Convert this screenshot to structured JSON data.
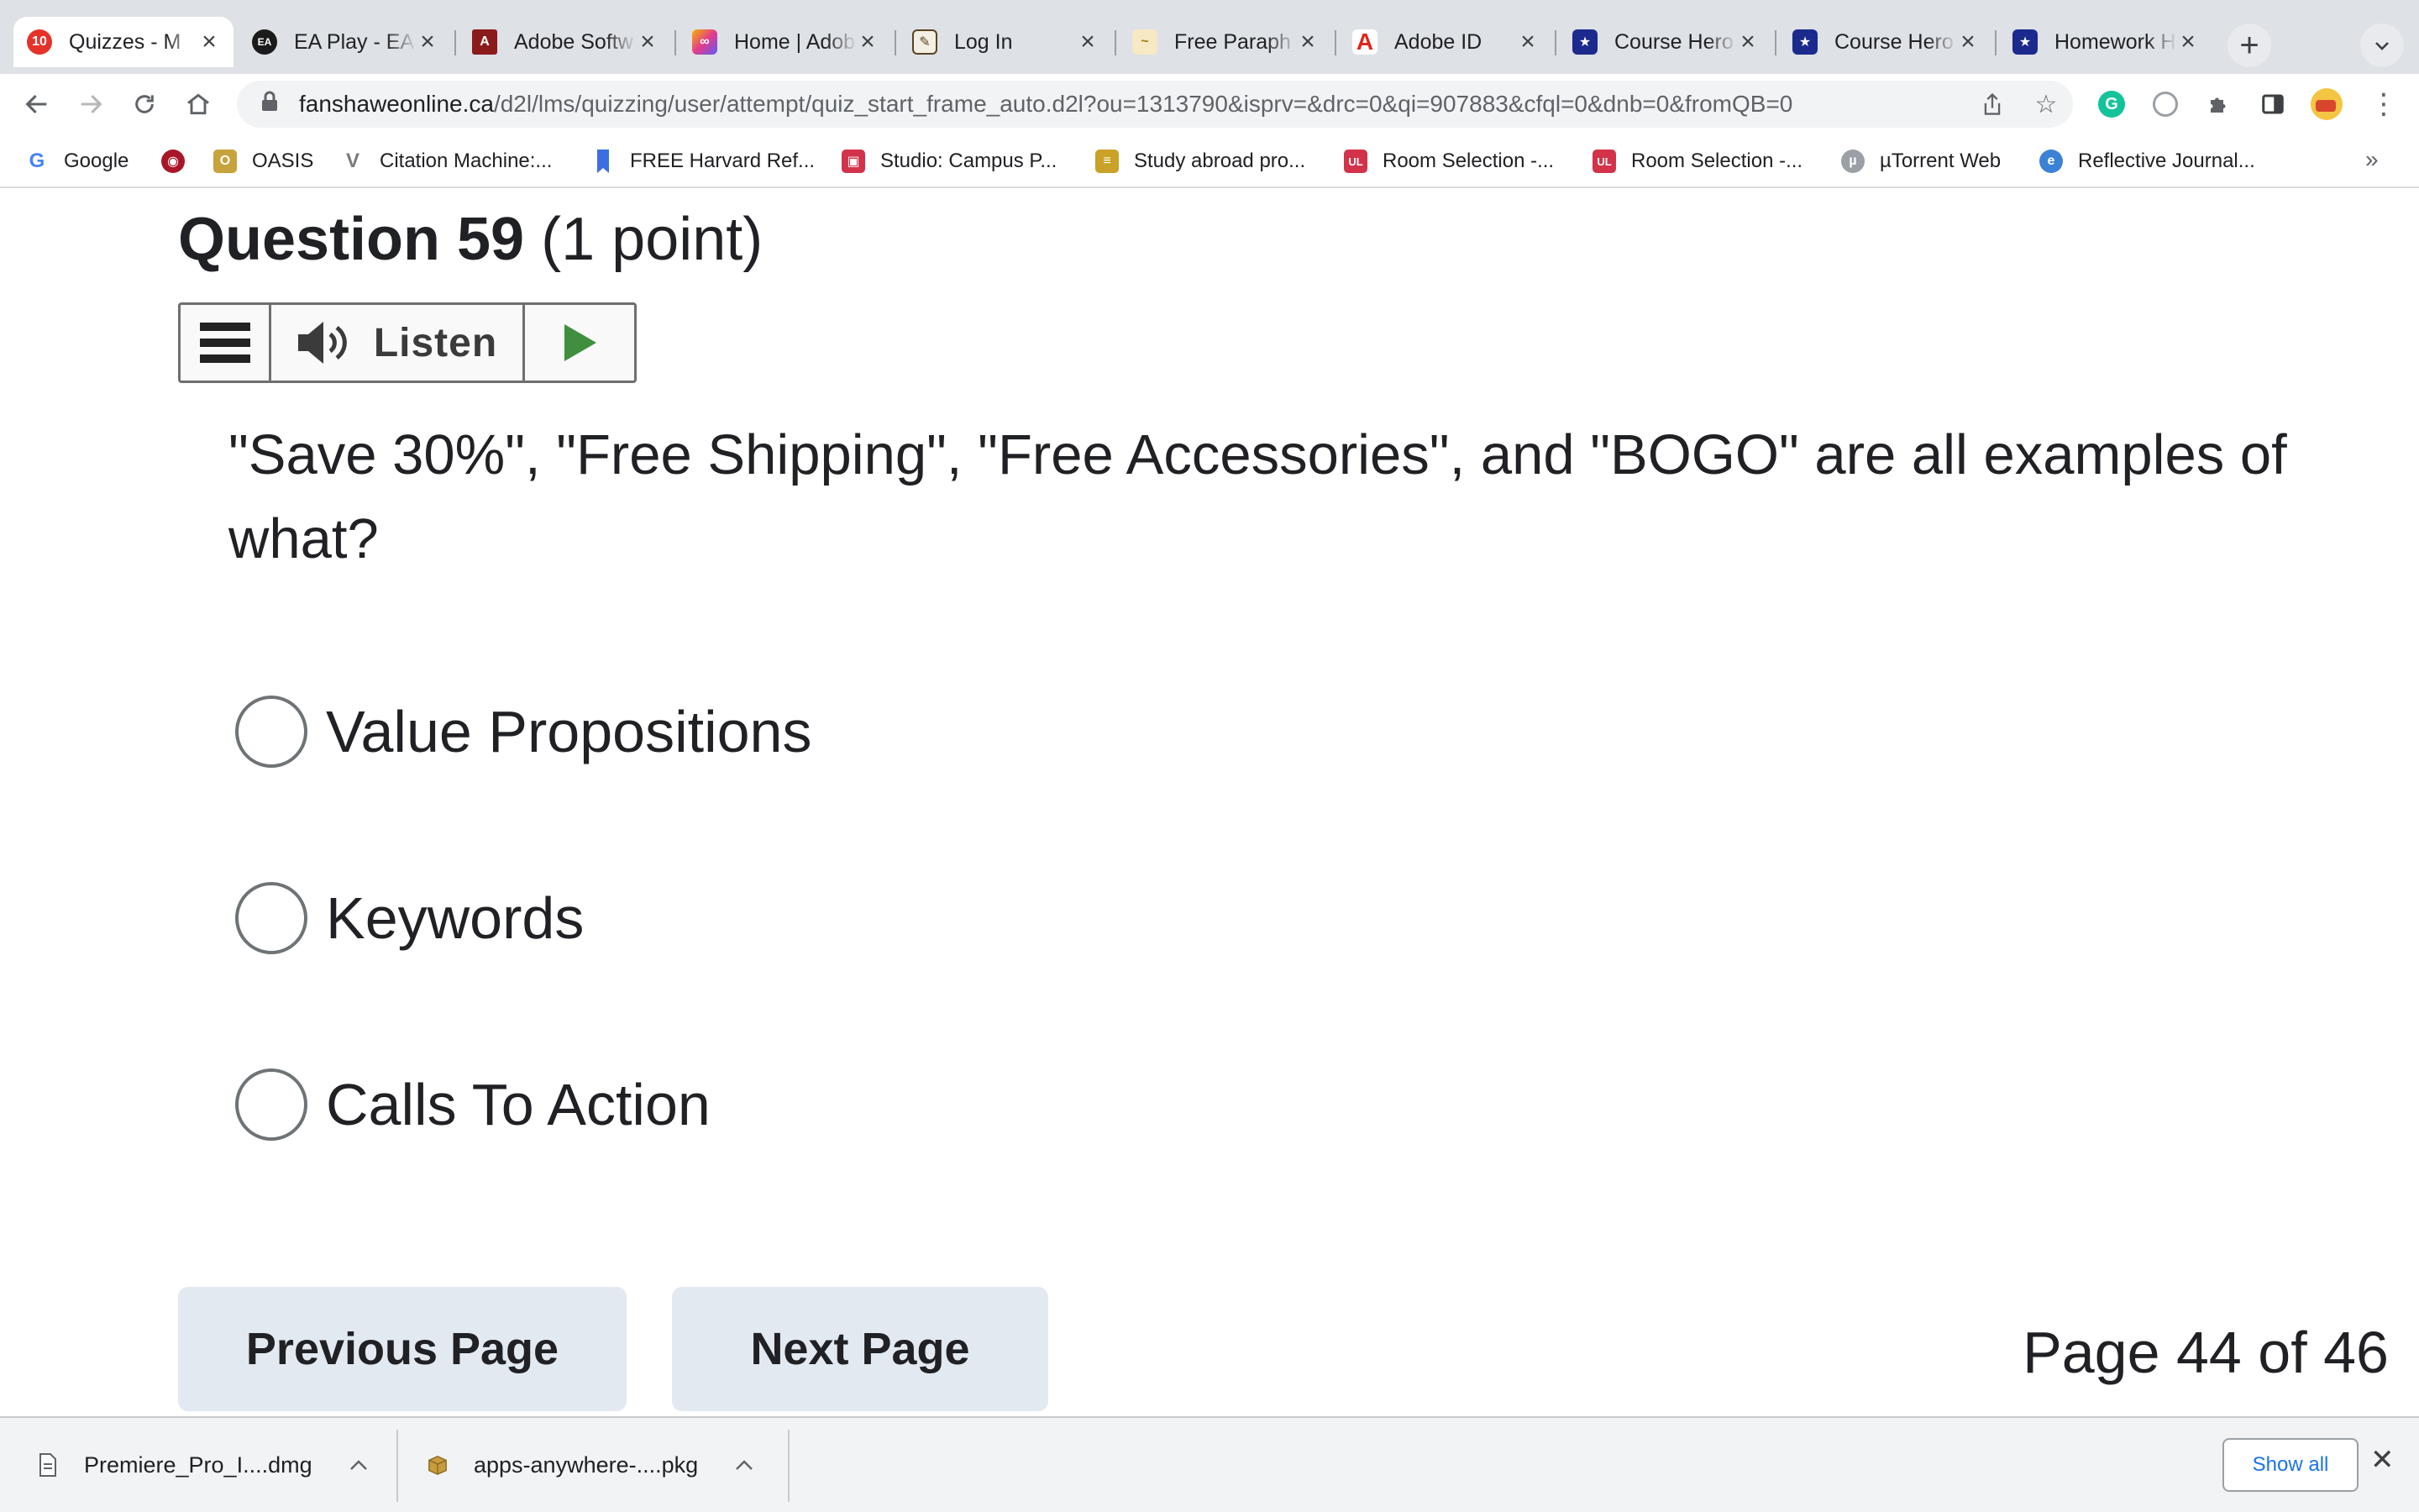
{
  "browser": {
    "tabs": [
      {
        "title": "Quizzes - M",
        "icon": "quizzes-favicon",
        "color": "#e5332a",
        "glyph": "10",
        "active": true
      },
      {
        "title": "EA Play - EA",
        "icon": "ea-favicon",
        "color": "#1b1b1b",
        "glyph": "EA"
      },
      {
        "title": "Adobe Softw",
        "icon": "adobe-software-favicon",
        "color": "#8b1a1a",
        "glyph": "A"
      },
      {
        "title": "Home | Adob",
        "icon": "creative-cloud-favicon",
        "color": "#d94bb6",
        "glyph": "∞"
      },
      {
        "title": "Log In",
        "icon": "login-favicon",
        "color": "#7a5c2e",
        "glyph": "✎"
      },
      {
        "title": "Free Paraph",
        "icon": "paraphrase-favicon",
        "color": "#c9a227",
        "glyph": "~"
      },
      {
        "title": "Adobe ID",
        "icon": "adobe-id-favicon",
        "color": "#e1251b",
        "glyph": "A"
      },
      {
        "title": "Course Hero",
        "icon": "course-hero-favicon",
        "color": "#1b2a8c",
        "glyph": "★"
      },
      {
        "title": "Course Hero",
        "icon": "course-hero-favicon",
        "color": "#1b2a8c",
        "glyph": "★"
      },
      {
        "title": "Homework H",
        "icon": "course-hero-favicon",
        "color": "#1b2a8c",
        "glyph": "★"
      }
    ],
    "new_tab_label": "+",
    "tab_search_label": "⌄",
    "url_domain": "fanshaweonline.ca",
    "url_path": "/d2l/lms/quizzing/user/attempt/quiz_start_frame_auto.d2l?ou=1313790&isprv=&drc=0&qi=907883&cfql=0&dnb=0&fromQB=0",
    "bookmarks": [
      {
        "label": "Google",
        "icon": "google-icon",
        "color": "#4285f4",
        "glyph": "G"
      },
      {
        "label": "",
        "icon": "ac-milan-icon",
        "color": "#a8162a",
        "glyph": "◉"
      },
      {
        "label": "OASIS",
        "icon": "oasis-icon",
        "color": "#c8a23c",
        "glyph": "O"
      },
      {
        "label": "Citation Machine:...",
        "icon": "citation-machine-icon",
        "color": "#7c7c7c",
        "glyph": "V"
      },
      {
        "label": "FREE Harvard Ref...",
        "icon": "bookmark-ribbon-icon",
        "color": "#3b6ee0",
        "glyph": "▮"
      },
      {
        "label": "Studio: Campus P...",
        "icon": "studio-icon",
        "color": "#d2334a",
        "glyph": "▣"
      },
      {
        "label": "Study abroad pro...",
        "icon": "study-abroad-icon",
        "color": "#c9a227",
        "glyph": "≡"
      },
      {
        "label": "Room Selection -...",
        "icon": "room-selection-icon",
        "color": "#d2334a",
        "glyph": "UL"
      },
      {
        "label": "Room Selection -...",
        "icon": "room-selection-icon",
        "color": "#d2334a",
        "glyph": "UL"
      },
      {
        "label": "µTorrent Web",
        "icon": "utorrent-icon",
        "color": "#9aa0a6",
        "glyph": "µ"
      },
      {
        "label": "Reflective Journal...",
        "icon": "reflective-journal-icon",
        "color": "#3b82d6",
        "glyph": "e"
      }
    ],
    "more_bookmarks": "»"
  },
  "quiz": {
    "question_number": "Question 59",
    "points": "(1 point)",
    "listen_label": "Listen",
    "question_text": "\"Save 30%\", \"Free Shipping\", \"Free Accessories\", and \"BOGO\" are all examples of what?",
    "options": [
      "Value Propositions",
      "Keywords",
      "Calls To Action"
    ],
    "previous_label": "Previous Page",
    "next_label": "Next Page",
    "page_indicator": "Page 44 of 46"
  },
  "downloads": {
    "items": [
      {
        "name": "Premiere_Pro_I....dmg",
        "icon": "file-icon"
      },
      {
        "name": "apps-anywhere-....pkg",
        "icon": "package-icon"
      }
    ],
    "show_all_label": "Show all"
  },
  "colors": {
    "accent_blue": "#1a73e8",
    "play_green": "#3f8f3f",
    "nav_button_bg": "#e3e9f1"
  }
}
